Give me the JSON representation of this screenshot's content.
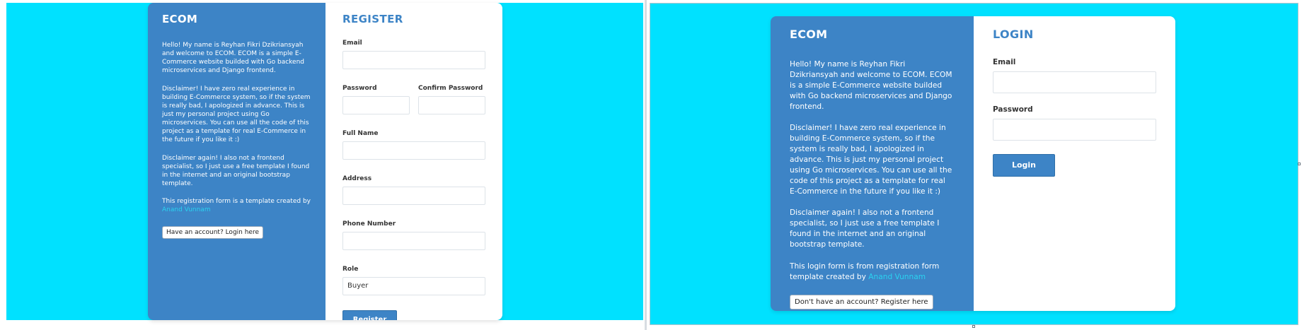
{
  "register_page": {
    "brand": "ECOM",
    "intro": "Hello! My name is Reyhan Fikri Dzikriansyah and welcome to ECOM. ECOM is a simple E-Commerce website builded with Go backend microservices and Django frontend.",
    "disclaimer": "Disclaimer! I have zero real experience in building E-Commerce system, so if the system is really bad, I apologized in advance. This is just my personal project using Go microservices. You can use all the code of this project as a template for real E-Commerce in the future if you like it :)",
    "disclaimer_again": "Disclaimer again! I also not a frontend specialist, so I just use a free template I found in the internet and an original bootstrap template.",
    "credit_prefix": "This registration form is a template created by ",
    "credit_name": "Anand Vunnam",
    "switch_button": "Have an account? Login here",
    "form_title": "REGISTER",
    "fields": {
      "email_label": "Email",
      "password_label": "Password",
      "confirm_password_label": "Confirm Password",
      "full_name_label": "Full Name",
      "address_label": "Address",
      "phone_label": "Phone Number",
      "role_label": "Role",
      "role_value": "Buyer"
    },
    "submit_label": "Register"
  },
  "login_page": {
    "brand": "ECOM",
    "intro": "Hello! My name is Reyhan Fikri Dzikriansyah and welcome to ECOM. ECOM is a simple E-Commerce website builded with Go backend microservices and Django frontend.",
    "disclaimer": "Disclaimer! I have zero real experience in building E-Commerce system, so if the system is really bad, I apologized in advance. This is just my personal project using Go microservices. You can use all the code of this project as a template for real E-Commerce in the future if you like it :)",
    "disclaimer_again": "Disclaimer again! I also not a frontend specialist, so I just use a free template I found in the internet and an original bootstrap template.",
    "credit_prefix": "This login form is from registration form template created by ",
    "credit_name": "Anand Vunnam",
    "switch_button": "Don't have an account? Register here",
    "form_title": "LOGIN",
    "fields": {
      "email_label": "Email",
      "password_label": "Password"
    },
    "submit_label": "Login"
  },
  "colors": {
    "background": "#00e1ff",
    "panel": "#3d84c6",
    "accent_link": "#2ad2f0",
    "form_title": "#3d84c6"
  }
}
